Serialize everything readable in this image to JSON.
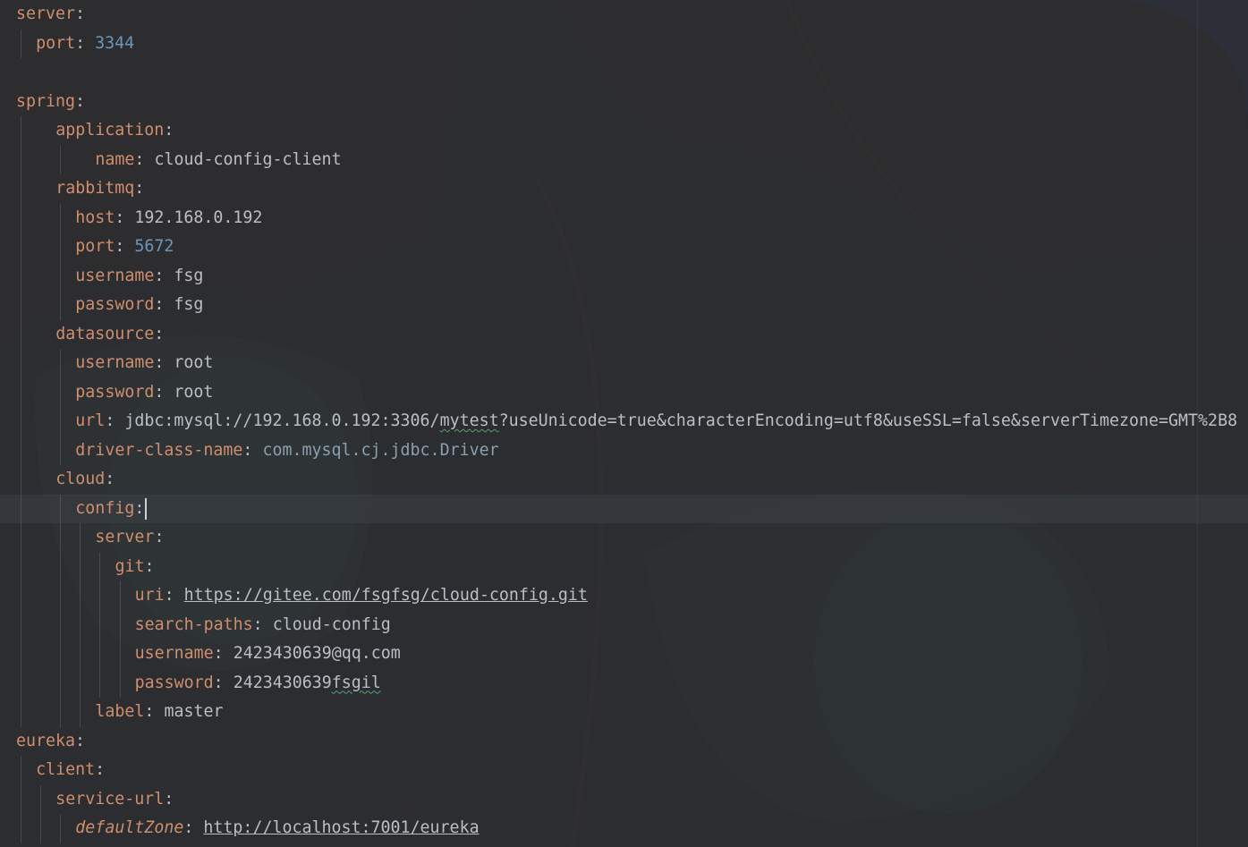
{
  "editor": {
    "language": "yaml",
    "lines": [
      {
        "indent": 0,
        "key": "server"
      },
      {
        "indent": 2,
        "key": "port",
        "value": "3344",
        "type": "num"
      },
      {
        "blank": true
      },
      {
        "indent": 0,
        "key": "spring"
      },
      {
        "indent": 4,
        "key": "application"
      },
      {
        "indent": 8,
        "key": "name",
        "value": "cloud-config-client",
        "type": "str"
      },
      {
        "indent": 4,
        "key": "rabbitmq"
      },
      {
        "indent": 6,
        "key": "host",
        "value": "192.168.0.192",
        "type": "str"
      },
      {
        "indent": 6,
        "key": "port",
        "value": "5672",
        "type": "num"
      },
      {
        "indent": 6,
        "key": "username",
        "value": "fsg",
        "type": "str"
      },
      {
        "indent": 6,
        "key": "password",
        "value": "fsg",
        "type": "str"
      },
      {
        "indent": 4,
        "key": "datasource"
      },
      {
        "indent": 6,
        "key": "username",
        "value": "root",
        "type": "str"
      },
      {
        "indent": 6,
        "key": "password",
        "value": "root",
        "type": "str"
      },
      {
        "indent": 6,
        "key": "url",
        "value_parts": [
          "jdbc:mysql://192.168.0.192:3306/",
          "mytest",
          "?useUnicode=true&characterEncoding=utf8&useSSL=false&serverTimezone=GMT%2B8"
        ],
        "type": "url-squiggle"
      },
      {
        "indent": 6,
        "key": "driver-class-name",
        "value_parts": [
          "com.mysql.cj.jdbc.",
          "Driver"
        ],
        "type": "cls"
      },
      {
        "indent": 4,
        "key": "cloud"
      },
      {
        "indent": 6,
        "key": "config",
        "current": true
      },
      {
        "indent": 8,
        "key": "server"
      },
      {
        "indent": 10,
        "key": "git"
      },
      {
        "indent": 12,
        "key": "uri",
        "value": "https://gitee.com/fsgfsg/cloud-config.git",
        "type": "link"
      },
      {
        "indent": 12,
        "key": "search-paths",
        "value": "cloud-config",
        "type": "str"
      },
      {
        "indent": 12,
        "key": "username",
        "value": "2423430639@qq.com",
        "type": "str"
      },
      {
        "indent": 12,
        "key": "password",
        "value_parts": [
          "2423430639",
          "fsgil"
        ],
        "type": "str-squiggle"
      },
      {
        "indent": 8,
        "key": "label",
        "value": "master",
        "type": "str"
      },
      {
        "indent": 0,
        "key": "eureka"
      },
      {
        "indent": 2,
        "key": "client"
      },
      {
        "indent": 4,
        "key": "service-url"
      },
      {
        "indent": 6,
        "key": "defaultZone",
        "value": "http://localhost:7001/eureka",
        "type": "link",
        "italic": true
      }
    ]
  }
}
